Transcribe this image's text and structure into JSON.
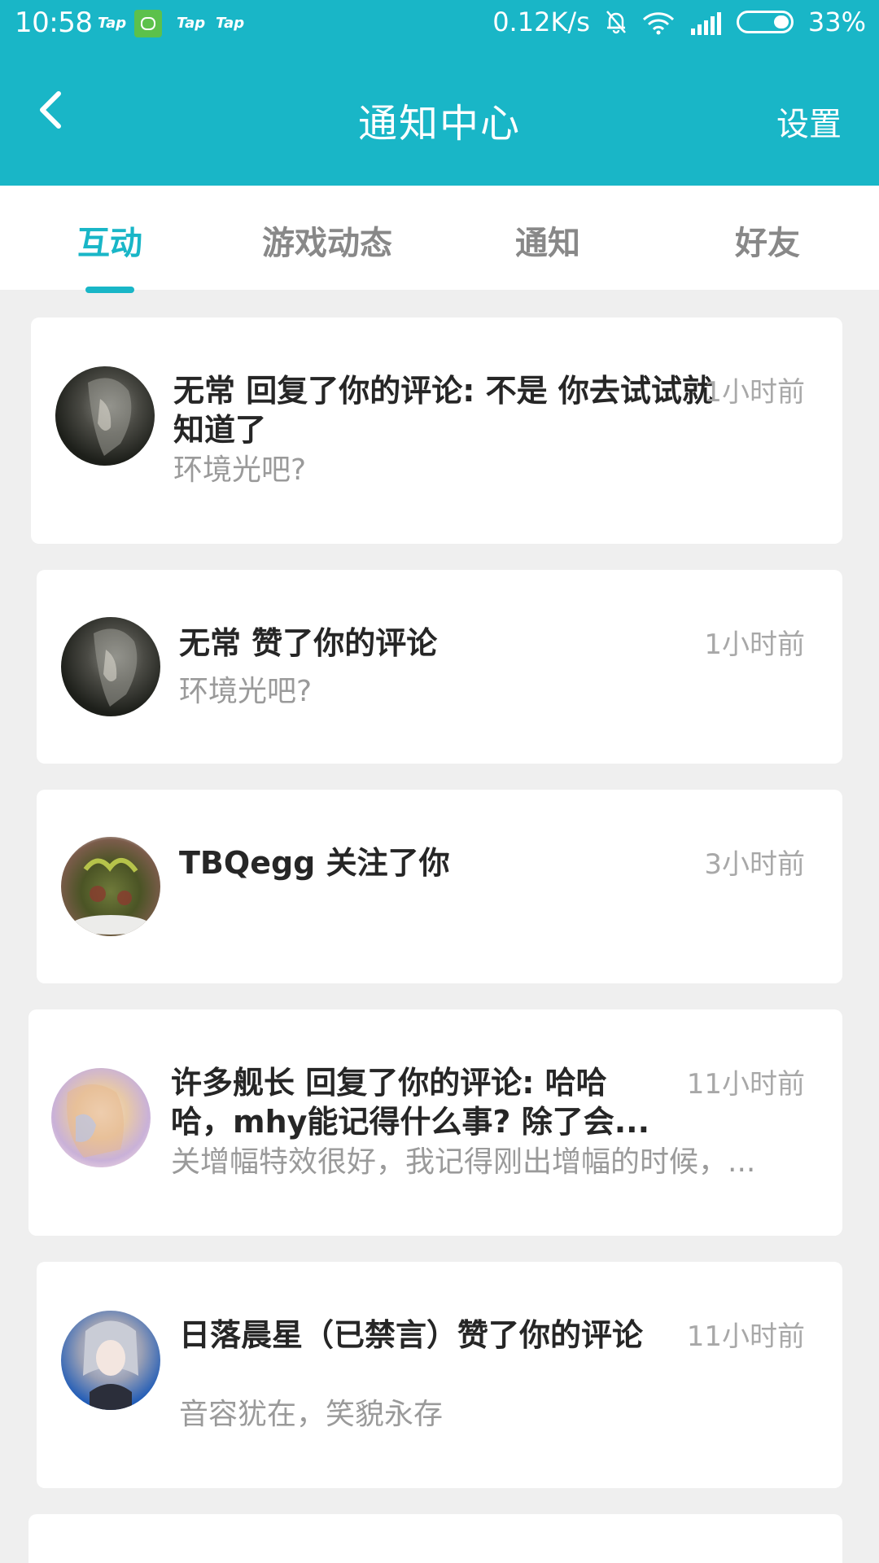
{
  "status_bar": {
    "time": "10:58",
    "apps": [
      "Tap",
      "Tap",
      "Tap"
    ],
    "net_speed": "0.12K/s",
    "battery": "33%",
    "battery_level": 0.33,
    "icons": [
      "app-cat-icon",
      "mute-bell-icon",
      "wifi-icon",
      "signal-icon",
      "battery-icon"
    ]
  },
  "appbar": {
    "title": "通知中心",
    "settings_label": "设置",
    "back_icon": "chevron-left-icon",
    "color": "#19b6c7"
  },
  "tabs": [
    {
      "label": "互动",
      "active": true
    },
    {
      "label": "游戏动态",
      "active": false
    },
    {
      "label": "通知",
      "active": false
    },
    {
      "label": "好友",
      "active": false
    }
  ],
  "notifications": [
    {
      "title": "无常 回复了你的评论: 不是 你去试试就知道了",
      "subtitle": "环境光吧?",
      "time": "1小时前"
    },
    {
      "title": "无常 赞了你的评论",
      "subtitle": "环境光吧?",
      "time": "1小时前"
    },
    {
      "title": "TBQegg 关注了你",
      "subtitle": "",
      "time": "3小时前"
    },
    {
      "title": "许多舰长 回复了你的评论: 哈哈哈，mhy能记得什么事? 除了会...",
      "subtitle": "关增幅特效很好，我记得刚出增幅的时候，...",
      "time": "11小时前"
    },
    {
      "title": "日落晨星（已禁言）赞了你的评论",
      "subtitle": "音容犹在，笑貌永存",
      "time": "11小时前"
    }
  ]
}
